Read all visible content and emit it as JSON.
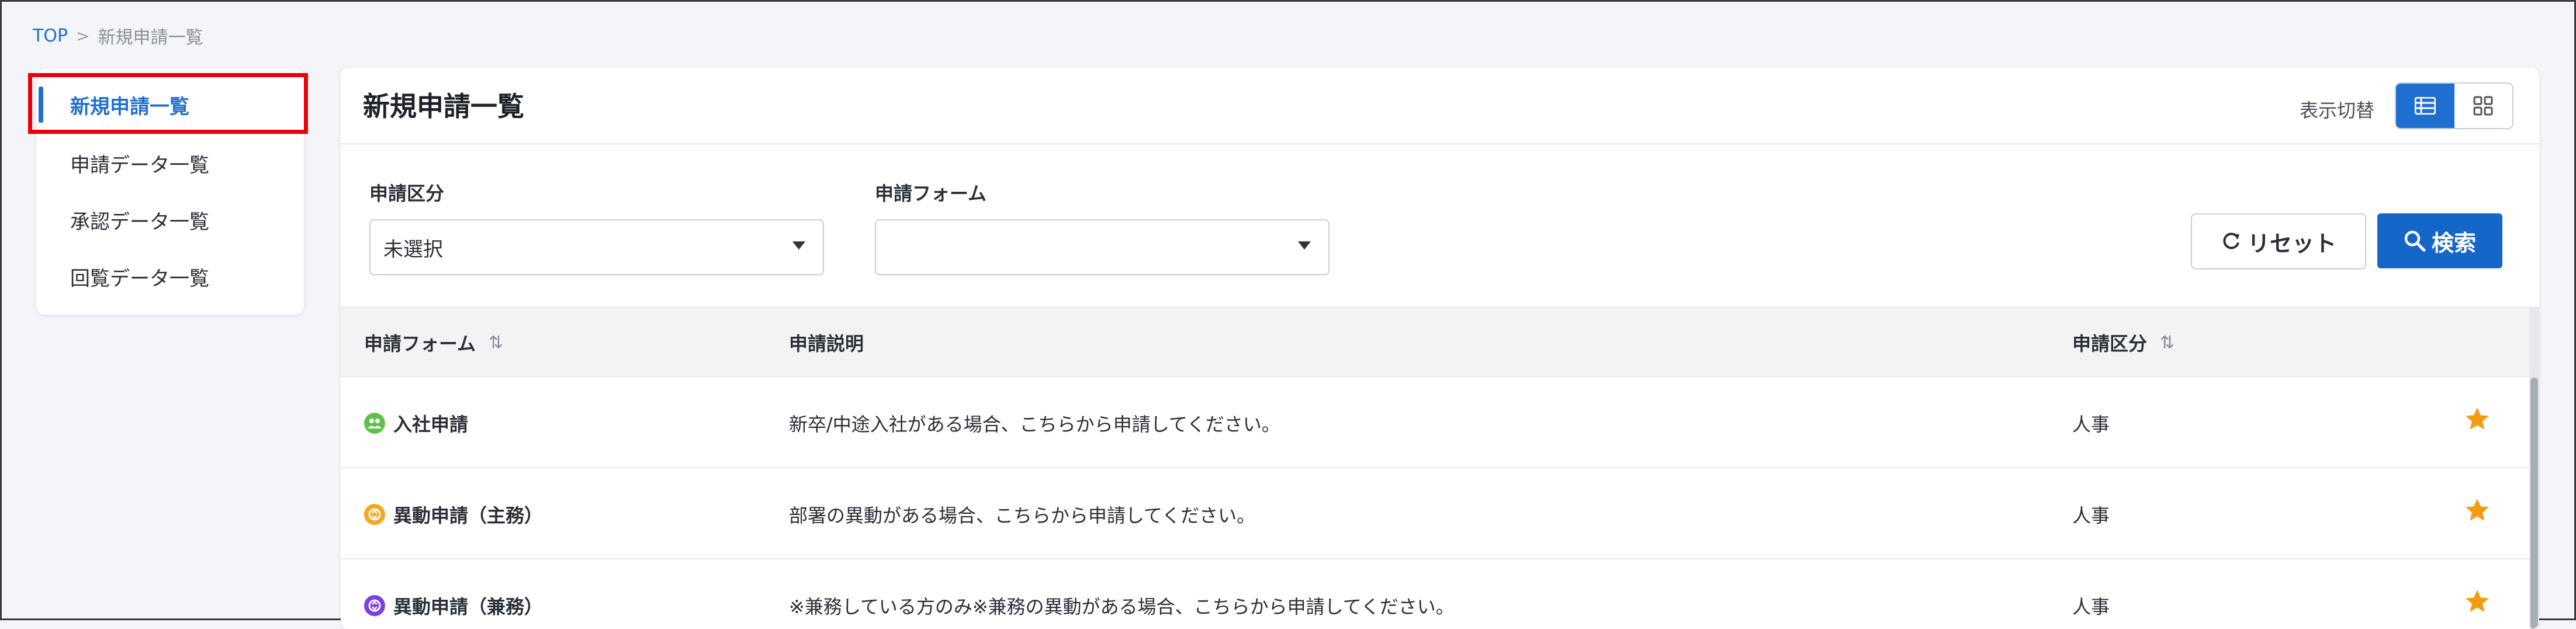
{
  "breadcrumb": {
    "top": "TOP",
    "separator": ">",
    "current": "新規申請一覧"
  },
  "sidebar": {
    "items": [
      {
        "label": "新規申請一覧",
        "active": true
      },
      {
        "label": "申請データ一覧",
        "active": false
      },
      {
        "label": "承認データ一覧",
        "active": false
      },
      {
        "label": "回覧データ一覧",
        "active": false
      }
    ]
  },
  "main": {
    "title": "新規申請一覧",
    "view_toggle_label": "表示切替",
    "view_modes": [
      {
        "icon": "list-view-icon",
        "active": true
      },
      {
        "icon": "grid-view-icon",
        "active": false
      }
    ]
  },
  "filters": {
    "category": {
      "label": "申請区分",
      "value": "未選択"
    },
    "form": {
      "label": "申請フォーム",
      "value": ""
    },
    "reset_label": "リセット",
    "search_label": "検索"
  },
  "table": {
    "headers": {
      "form": "申請フォーム",
      "description": "申請説明",
      "category": "申請区分"
    },
    "rows": [
      {
        "name": "入社申請",
        "description": "新卒/中途入社がある場合、こちらから申請してください。",
        "category": "人事",
        "icon": "people-icon",
        "icon_color": "#5cc24a",
        "favorite": true
      },
      {
        "name": "異動申請（主務）",
        "description": "部署の異動がある場合、こちらから申請してください。",
        "category": "人事",
        "icon": "transfer-icon",
        "icon_color": "#f5a623",
        "favorite": true
      },
      {
        "name": "異動申請（兼務）",
        "description": "※兼務している方のみ※兼務の異動がある場合、こちらから申請してください。",
        "category": "人事",
        "icon": "transfer-icon",
        "icon_color": "#7b3fe4",
        "favorite": true
      }
    ]
  },
  "colors": {
    "accent": "#1f6fd1",
    "star": "#f39c12",
    "highlight": "#e8000b"
  }
}
